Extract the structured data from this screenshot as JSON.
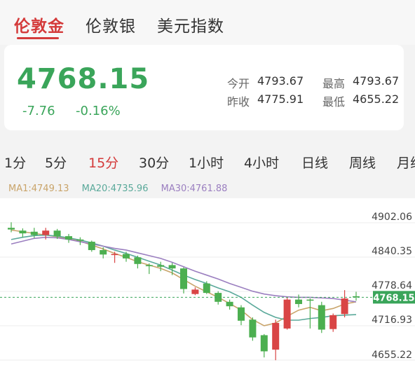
{
  "tabs": [
    {
      "label": "伦敦金",
      "active": true
    },
    {
      "label": "伦敦银",
      "active": false
    },
    {
      "label": "美元指数",
      "active": false
    }
  ],
  "quote": {
    "price": "4768.15",
    "change": "-7.76",
    "change_pct": "-0.16%",
    "open_label": "今开",
    "open": "4793.67",
    "high_label": "最高",
    "high": "4793.67",
    "prev_close_label": "昨收",
    "prev_close": "4775.91",
    "low_label": "最低",
    "low": "4655.22"
  },
  "periods": [
    {
      "label": "1分",
      "active": false
    },
    {
      "label": "5分",
      "active": false
    },
    {
      "label": "15分",
      "active": true
    },
    {
      "label": "30分",
      "active": false
    },
    {
      "label": "1小时",
      "active": false
    },
    {
      "label": "4小时",
      "active": false
    },
    {
      "label": "日线",
      "active": false
    },
    {
      "label": "周线",
      "active": false
    },
    {
      "label": "月线",
      "active": false
    }
  ],
  "ma": [
    {
      "label": "MA1:4749.13",
      "color": "#c9a46a"
    },
    {
      "label": "MA20:4735.96",
      "color": "#5aa99a"
    },
    {
      "label": "MA30:4761.88",
      "color": "#9b7fc0"
    }
  ],
  "colors": {
    "up": "#d94545",
    "down": "#4caf50",
    "price": "#3aa55a",
    "accent": "#d43a3a"
  },
  "chart_data": {
    "type": "candlestick",
    "y_ticks": [
      "4902.06",
      "4840.35",
      "4778.64",
      "4716.93",
      "4655.22"
    ],
    "current_price": "4768.15",
    "candles": [
      {
        "o": 4893,
        "c": 4890,
        "h": 4903,
        "l": 4885
      },
      {
        "o": 4888,
        "c": 4883,
        "h": 4892,
        "l": 4876
      },
      {
        "o": 4886,
        "c": 4880,
        "h": 4893,
        "l": 4875
      },
      {
        "o": 4880,
        "c": 4888,
        "h": 4893,
        "l": 4872
      },
      {
        "o": 4888,
        "c": 4878,
        "h": 4891,
        "l": 4873
      },
      {
        "o": 4878,
        "c": 4872,
        "h": 4882,
        "l": 4866
      },
      {
        "o": 4872,
        "c": 4870,
        "h": 4876,
        "l": 4862
      },
      {
        "o": 4868,
        "c": 4853,
        "h": 4870,
        "l": 4850
      },
      {
        "o": 4853,
        "c": 4845,
        "h": 4858,
        "l": 4838
      },
      {
        "o": 4844,
        "c": 4846,
        "h": 4850,
        "l": 4830
      },
      {
        "o": 4846,
        "c": 4838,
        "h": 4850,
        "l": 4832
      },
      {
        "o": 4840,
        "c": 4828,
        "h": 4843,
        "l": 4820
      },
      {
        "o": 4826,
        "c": 4824,
        "h": 4829,
        "l": 4810
      },
      {
        "o": 4826,
        "c": 4823,
        "h": 4832,
        "l": 4815
      },
      {
        "o": 4826,
        "c": 4820,
        "h": 4830,
        "l": 4808
      },
      {
        "o": 4820,
        "c": 4783,
        "h": 4822,
        "l": 4775
      },
      {
        "o": 4774,
        "c": 4782,
        "h": 4786,
        "l": 4772
      },
      {
        "o": 4793,
        "c": 4776,
        "h": 4797,
        "l": 4774
      },
      {
        "o": 4776,
        "c": 4760,
        "h": 4779,
        "l": 4755
      },
      {
        "o": 4760,
        "c": 4752,
        "h": 4764,
        "l": 4746
      },
      {
        "o": 4750,
        "c": 4726,
        "h": 4754,
        "l": 4718
      },
      {
        "o": 4728,
        "c": 4696,
        "h": 4732,
        "l": 4690
      },
      {
        "o": 4700,
        "c": 4671,
        "h": 4702,
        "l": 4660
      },
      {
        "o": 4674,
        "c": 4722,
        "h": 4728,
        "l": 4655
      },
      {
        "o": 4712,
        "c": 4764,
        "h": 4768,
        "l": 4710
      },
      {
        "o": 4764,
        "c": 4756,
        "h": 4773,
        "l": 4750
      },
      {
        "o": 4764,
        "c": 4762,
        "h": 4766,
        "l": 4712
      },
      {
        "o": 4754,
        "c": 4710,
        "h": 4760,
        "l": 4704
      },
      {
        "o": 4711,
        "c": 4736,
        "h": 4739,
        "l": 4706
      },
      {
        "o": 4738,
        "c": 4766,
        "h": 4781,
        "l": 4732
      },
      {
        "o": 4770,
        "c": 4768,
        "h": 4778,
        "l": 4762
      }
    ],
    "ma_lines": [
      {
        "name": "MA1",
        "values": [
          4889,
          4886,
          4883,
          4880,
          4877,
          4873,
          4869,
          4862,
          4855,
          4847,
          4840,
          4832,
          4826,
          4820,
          4812,
          4800,
          4788,
          4778,
          4768,
          4757,
          4745,
          4728,
          4717,
          4722,
          4734,
          4745,
          4750,
          4744,
          4748,
          4756,
          4760
        ]
      },
      {
        "name": "MA20",
        "values": [
          4872,
          4876,
          4879,
          4880,
          4878,
          4875,
          4871,
          4866,
          4860,
          4853,
          4847,
          4840,
          4833,
          4826,
          4817,
          4808,
          4800,
          4793,
          4785,
          4778,
          4768,
          4754,
          4741,
          4732,
          4727,
          4727,
          4730,
          4732,
          4735,
          4736,
          4737
        ]
      },
      {
        "name": "MA30",
        "values": [
          4864,
          4869,
          4874,
          4876,
          4875,
          4872,
          4868,
          4864,
          4860,
          4856,
          4853,
          4848,
          4843,
          4838,
          4831,
          4823,
          4815,
          4808,
          4801,
          4793,
          4786,
          4779,
          4774,
          4771,
          4769,
          4768,
          4768,
          4767,
          4766,
          4763,
          4760
        ]
      }
    ]
  }
}
